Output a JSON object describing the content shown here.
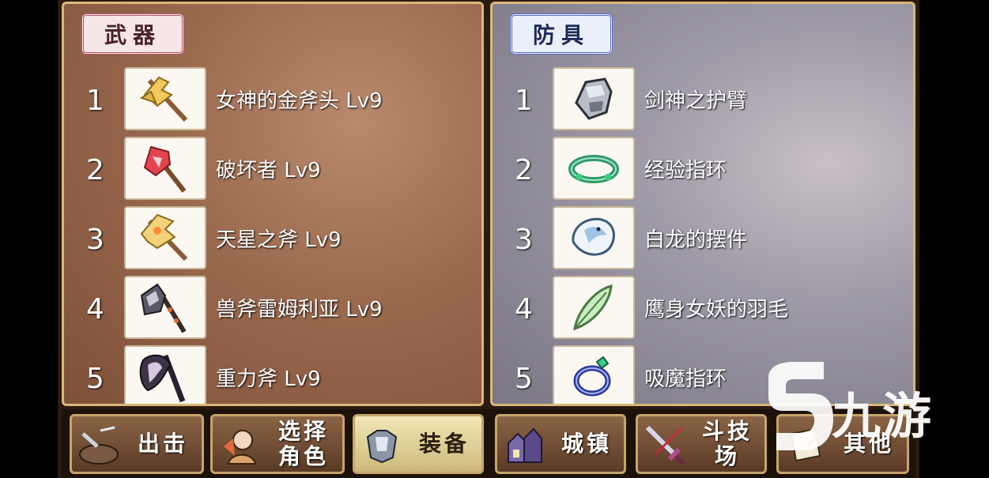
{
  "weapons": {
    "title": "武器",
    "items": [
      {
        "num": "1",
        "name": "女神的金斧头 Lv9",
        "icon": "golden-axe-icon"
      },
      {
        "num": "2",
        "name": "破坏者 Lv9",
        "icon": "red-axe-icon"
      },
      {
        "num": "3",
        "name": "天星之斧 Lv9",
        "icon": "star-axe-icon"
      },
      {
        "num": "4",
        "name": "兽斧雷姆利亚 Lv9",
        "icon": "beast-axe-icon"
      },
      {
        "num": "5",
        "name": "重力斧 Lv9",
        "icon": "gravity-axe-icon"
      }
    ]
  },
  "armor": {
    "title": "防具",
    "items": [
      {
        "num": "1",
        "name": "剑神之护臂",
        "icon": "gauntlet-icon"
      },
      {
        "num": "2",
        "name": "经验指环",
        "icon": "green-ring-icon"
      },
      {
        "num": "3",
        "name": "白龙的摆件",
        "icon": "white-dragon-icon"
      },
      {
        "num": "4",
        "name": "鹰身女妖的羽毛",
        "icon": "feather-icon"
      },
      {
        "num": "5",
        "name": "吸魔指环",
        "icon": "blue-ring-icon"
      }
    ]
  },
  "nav": [
    {
      "label": "出击",
      "icon": "sortie-icon"
    },
    {
      "label": "选择角色",
      "label_line1": "选择",
      "label_line2": "角色",
      "icon": "character-icon"
    },
    {
      "label": "装备",
      "icon": "armor-icon",
      "active": true
    },
    {
      "label": "城镇",
      "icon": "town-icon"
    },
    {
      "label": "斗技场",
      "icon": "sword-icon"
    },
    {
      "label": "其他",
      "icon": "scroll-icon"
    }
  ],
  "watermark": {
    "text": "九游",
    "logo_icon": "jiuyou-logo-icon"
  }
}
